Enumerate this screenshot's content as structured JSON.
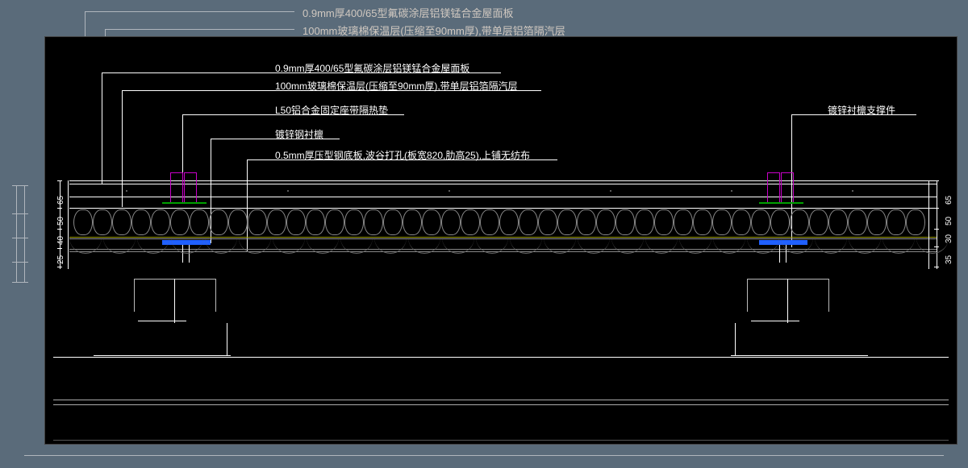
{
  "bg_labels": {
    "roof_panel": "0.9mm厚400/65型氟碳涂层铝镁锰合金屋面板",
    "insulation": "100mm玻璃棉保温层(压缩至90mm厚),带单层铝箔隔汽层"
  },
  "labels": {
    "l1": "0.9mm厚400/65型氟碳涂层铝镁锰合金屋面板",
    "l2": "100mm玻璃棉保温层(压缩至90mm厚),带单层铝箔隔汽层",
    "l3": "L50铝合金固定座带隔热垫",
    "l4": "镀锌钢衬檩",
    "l5": "0.5mm厚压型钢底板,波谷打孔(板宽820,肋高25),上铺无纺布",
    "r1": "镀锌衬檩支撑件"
  },
  "dims_left": {
    "d1": "65",
    "d2": "50",
    "d3": "40",
    "d4": "25"
  },
  "dims_right": {
    "d1": "65",
    "d2": "50",
    "d3": "30",
    "d4": "35"
  }
}
